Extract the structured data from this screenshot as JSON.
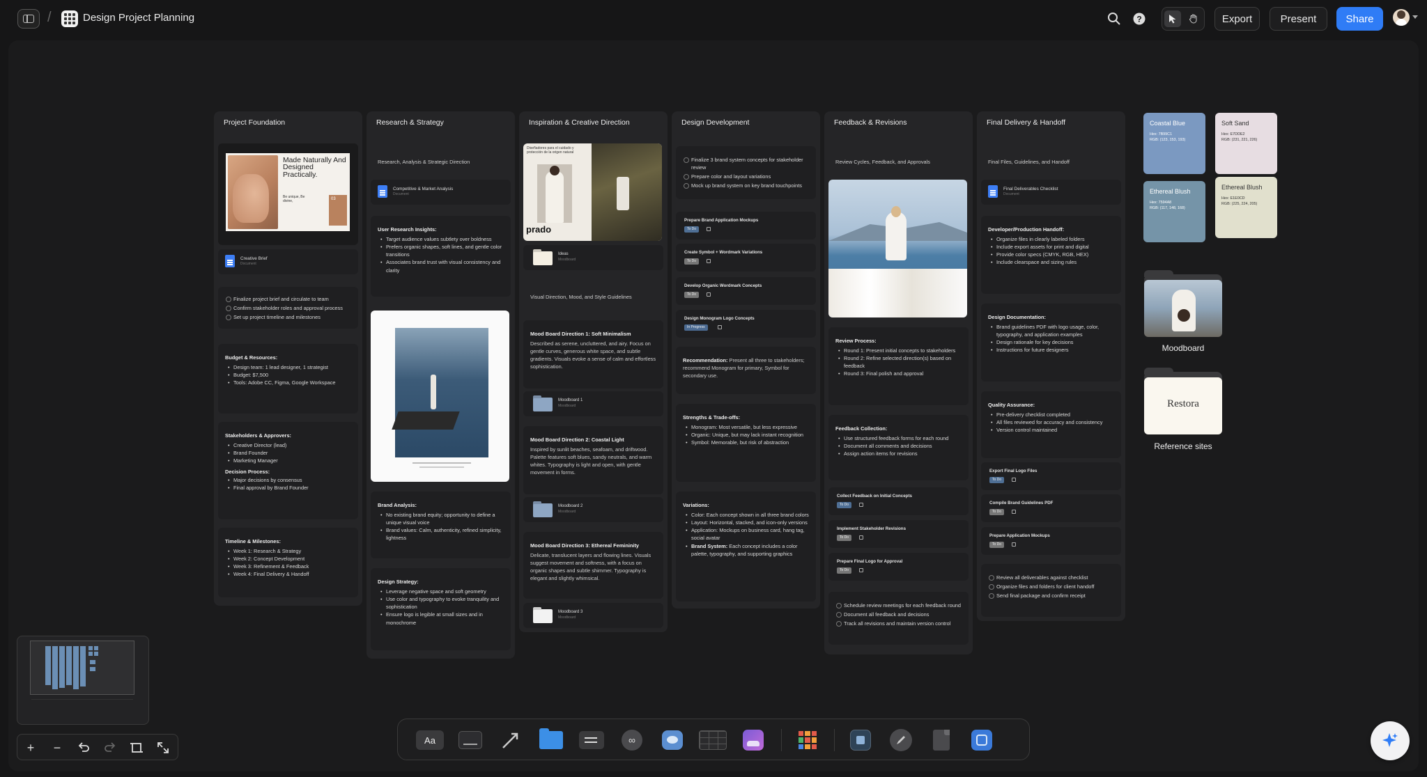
{
  "topbar": {
    "title": "Design Project Planning",
    "export_label": "Export",
    "present_label": "Present",
    "share_label": "Share"
  },
  "columns": [
    {
      "title": "Project Foundation",
      "image_caption": {
        "headline": "Made Naturally And Designed Practically.",
        "tagline": "Be unique, Be divine,",
        "badge": "03"
      },
      "doc": {
        "title": "Creative Brief",
        "subtitle": "Document"
      },
      "checklist": [
        "Finalize project brief and circulate to team",
        "Confirm stakeholder roles and approval process",
        "Set up project timeline and milestones"
      ],
      "budget": {
        "heading": "Budget & Resources:",
        "items": [
          "Design team: 1 lead designer, 1 strategist",
          "Budget: $7,500",
          "Tools: Adobe CC, Figma, Google Workspace"
        ]
      },
      "stakeholders": {
        "heading": "Stakeholders & Approvers:",
        "items": [
          "Creative Director (lead)",
          "Brand Founder",
          "Marketing Manager"
        ],
        "heading2": "Decision Process:",
        "items2": [
          "Major decisions by consensus",
          "Final approval by Brand Founder"
        ]
      },
      "timeline": {
        "heading": "Timeline & Milestones:",
        "items": [
          "Week 1: Research & Strategy",
          "Week 2: Concept Development",
          "Week 3: Refinement & Feedback",
          "Week 4: Final Delivery & Handoff"
        ]
      }
    },
    {
      "title": "Research & Strategy",
      "intro": "Research, Analysis & Strategic Direction",
      "doc": {
        "title": "Competitive & Market Analysis",
        "subtitle": "Document"
      },
      "insights": {
        "heading": "User Research Insights:",
        "items": [
          "Target audience values subtlety over boldness",
          "Prefers organic shapes, soft lines, and gentle color transitions",
          "Associates brand trust with visual consistency and clarity"
        ]
      },
      "brand": {
        "heading": "Brand Analysis:",
        "items": [
          "No existing brand equity; opportunity to define a unique visual voice",
          "Brand values: Calm, authenticity, refined simplicity, lightness"
        ]
      },
      "strategy": {
        "heading": "Design Strategy:",
        "items": [
          "Leverage negative space and soft geometry",
          "Use color and typography to evoke tranquility and sophistication",
          "Ensure logo is legible at small sizes and in monochrome"
        ]
      }
    },
    {
      "title": "Inspiration & Creative Direction",
      "image_caption": {
        "headline": "Diseñadores para el cuidado y protección de la origen natural",
        "brand": "prado"
      },
      "folder_ideas": {
        "title": "Ideas",
        "subtitle": "Moodboard"
      },
      "intro": "Visual Direction, Mood, and Style Guidelines",
      "mb1": {
        "heading": "Mood Board Direction 1: Soft Minimalism",
        "text": "Described as serene, uncluttered, and airy. Focus on gentle curves, generous white space, and subtle gradients. Visuals evoke a sense of calm and effortless sophistication."
      },
      "folder1": {
        "title": "Moodboard 1",
        "subtitle": "Moodboard"
      },
      "mb2": {
        "heading": "Mood Board Direction 2: Coastal Light",
        "text": "Inspired by sunlit beaches, seafoam, and driftwood. Palette features soft blues, sandy neutrals, and warm whites. Typography is light and open, with gentle movement in forms."
      },
      "folder2": {
        "title": "Moodboard 2",
        "subtitle": "Moodboard"
      },
      "mb3": {
        "heading": "Mood Board Direction 3: Ethereal Femininity",
        "text": "Delicate, translucent layers and flowing lines. Visuals suggest movement and softness, with a focus on organic shapes and subtle shimmer. Typography is elegant and slightly whimsical."
      },
      "folder3": {
        "title": "Moodboard 3",
        "subtitle": "Moodboard"
      }
    },
    {
      "title": "Design Development",
      "checklist": [
        "Finalize 3 brand system concepts for stakeholder review",
        "Prepare color and layout variations",
        "Mock up brand system on key brand touchpoints"
      ],
      "tasks": [
        {
          "title": "Prepare Brand Application Mockups",
          "status": "To Do"
        },
        {
          "title": "Create Symbol + Wordmark Variations",
          "status": "To Do"
        },
        {
          "title": "Develop Organic Wordmark Concepts",
          "status": "To Do"
        },
        {
          "title": "Design Monogram Logo Concepts",
          "status": "In Progress"
        }
      ],
      "recommendation": {
        "heading": "Recommendation:",
        "text": "Present all three to stakeholders; recommend Monogram for primary, Symbol for secondary use."
      },
      "tradeoffs": {
        "heading": "Strengths & Trade-offs:",
        "items": [
          "Monogram: Most versatile, but less expressive",
          "Organic: Unique, but may lack instant recognition",
          "Symbol: Memorable, but risk of abstraction"
        ]
      },
      "variations": {
        "heading": "Variations:",
        "items": [
          "Color: Each concept shown in all three brand colors",
          "Layout: Horizontal, stacked, and icon-only versions",
          "Application: Mockups on business card, hang tag, social avatar"
        ],
        "brand_system_label": "Brand System:",
        "brand_system_text": "Each concept includes a color palette, typography, and supporting graphics"
      }
    },
    {
      "title": "Feedback & Revisions",
      "intro": "Review Cycles, Feedback, and Approvals",
      "review": {
        "heading": "Review Process:",
        "items": [
          "Round 1: Present initial concepts to stakeholders",
          "Round 2: Refine selected direction(s) based on feedback",
          "Round 3: Final polish and approval"
        ]
      },
      "collection": {
        "heading": "Feedback Collection:",
        "items": [
          "Use structured feedback forms for each round",
          "Document all comments and decisions",
          "Assign action items for revisions"
        ]
      },
      "tasks": [
        {
          "title": "Collect Feedback on Initial Concepts",
          "status": "To Do"
        },
        {
          "title": "Implement Stakeholder Revisions",
          "status": "To Do"
        },
        {
          "title": "Prepare Final Logo for Approval",
          "status": "To Do"
        }
      ],
      "checklist": [
        "Schedule review meetings for each feedback round",
        "Document all feedback and decisions",
        "Track all revisions and maintain version control"
      ]
    },
    {
      "title": "Final Delivery & Handoff",
      "intro": "Final Files, Guidelines, and Handoff",
      "doc": {
        "title": "Final Deliverables Checklist",
        "subtitle": "Document"
      },
      "handoff": {
        "heading": "Developer/Production Handoff:",
        "items": [
          "Organize files in clearly labeled folders",
          "Include export assets for print and digital",
          "Provide color specs (CMYK, RGB, HEX)",
          "Include clearspace and sizing rules"
        ]
      },
      "documentation": {
        "heading": "Design Documentation:",
        "items": [
          "Brand guidelines PDF with logo usage, color, typography, and application examples",
          "Design rationale for key decisions",
          "Instructions for future designers"
        ]
      },
      "qa": {
        "heading": "Quality Assurance:",
        "items": [
          "Pre-delivery checklist completed",
          "All files reviewed for accuracy and consistency",
          "Version control maintained"
        ]
      },
      "tasks": [
        {
          "title": "Export Final Logo Files",
          "status": "To Do"
        },
        {
          "title": "Compile Brand Guidelines PDF",
          "status": "To Do"
        },
        {
          "title": "Prepare Application Mockups",
          "status": "To Do"
        }
      ],
      "checklist": [
        "Review all deliverables against checklist",
        "Organize files and folders for client handoff",
        "Send final package and confirm receipt"
      ]
    }
  ],
  "swatches": [
    {
      "name": "Coastal Blue",
      "hex_label": "Hex: 7B99C1",
      "rgb_label": "RGB: (123, 153, 193)",
      "color": "#7b99c1"
    },
    {
      "name": "Soft Sand",
      "hex_label": "Hex: E7DDE2",
      "rgb_label": "RGB: (231, 221, 226)",
      "color": "#e7dde2"
    },
    {
      "name": "Ethereal Blush",
      "hex_label": "Hex: 7594A8",
      "rgb_label": "RGB: (117, 148, 168)",
      "color": "#7594a8"
    },
    {
      "name": "Ethereal Blush",
      "hex_label": "Hex: E1E0CD",
      "rgb_label": "RGB: (225, 224, 205)",
      "color": "#e1e0cd"
    }
  ],
  "folders": {
    "moodboard_label": "Moodboard",
    "reference_label": "Reference sites",
    "reference_logo": "Restora"
  },
  "dock": {
    "text_tool_label": "Aa"
  }
}
